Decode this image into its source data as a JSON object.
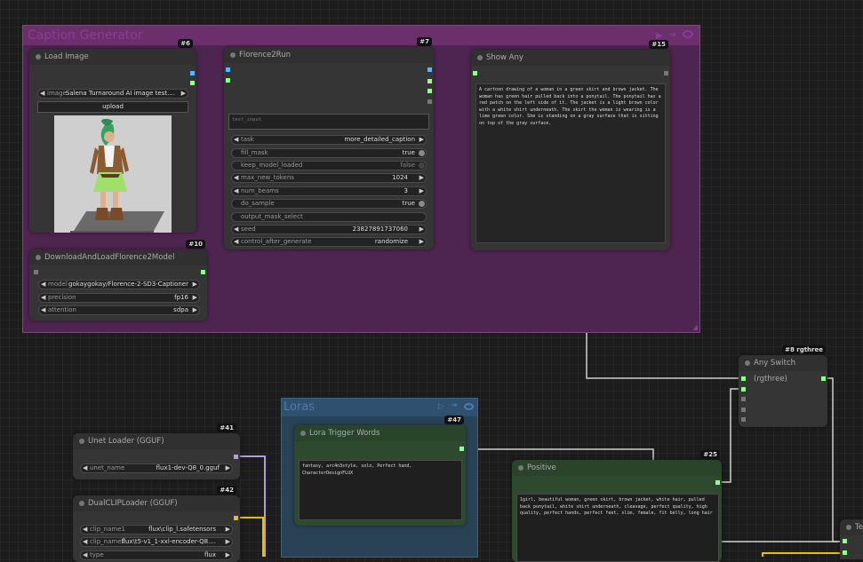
{
  "colors": {
    "canvas": "#1c1c1c",
    "caption_group": "#5a2a5a",
    "loras_group": "#2b4559",
    "green_node": "#2d4a2f",
    "socket_green": "#8fff8f",
    "socket_blue": "#5ab4ff",
    "wire_yellow": "#e6c300",
    "wire_purple": "#b39ddb"
  },
  "groups": {
    "caption": {
      "title": "Caption Generator"
    },
    "loras": {
      "title": "Loras"
    }
  },
  "icons": [
    "play-icon",
    "bypass-icon",
    "eye-icon"
  ],
  "nodes": {
    "load_image": {
      "title": "Load Image",
      "badge": "#6",
      "image": {
        "label": "image",
        "value": "Salena Turnaround AI image test...."
      },
      "upload_label": "upload"
    },
    "download_florence": {
      "title": "DownloadAndLoadFlorence2Model",
      "badge": "#10",
      "model": {
        "label": "model",
        "value": "gokaygokay/Florence-2-SD3-Captioner"
      },
      "precision": {
        "label": "precision",
        "value": "fp16"
      },
      "attention": {
        "label": "attention",
        "value": "sdpa"
      }
    },
    "florence2run": {
      "title": "Florence2Run",
      "badge": "#7",
      "text_input_placeholder": "text_input",
      "task": {
        "label": "task",
        "value": "more_detailed_caption"
      },
      "fill_mask": {
        "label": "fill_mask",
        "value": "true"
      },
      "keep_model_loaded": {
        "label": "keep_model_loaded",
        "value": "false"
      },
      "max_new_tokens": {
        "label": "max_new_tokens",
        "value": "1024"
      },
      "num_beams": {
        "label": "num_beams",
        "value": "3"
      },
      "do_sample": {
        "label": "do_sample",
        "value": "true"
      },
      "output_mask_select": {
        "label": "output_mask_select"
      },
      "seed": {
        "label": "seed",
        "value": "238278917370​60"
      },
      "control_after_generate": {
        "label": "control_after_generate",
        "value": "randomize"
      }
    },
    "show_any": {
      "title": "Show Any",
      "badge": "#15",
      "text": "A cartoon drawing of a woman in a green skirt and brown jacket. The woman has green hair pulled back into a ponytail. The ponytail has a red patch on the left side of it. The jacket is a light brown color with a white shirt underneath. The skirt the woman is wearing is a lime green color. She is standing on a gray surface that is sitting on top of the gray surface."
    },
    "any_switch": {
      "title": "Any Switch (rgthree)",
      "badge": "#8 rgthree"
    },
    "unet_loader": {
      "title": "Unet Loader (GGUF)",
      "badge": "#41",
      "unet_name": {
        "label": "unet_name",
        "value": "flux1-dev-Q8_0.gguf"
      }
    },
    "dualclip": {
      "title": "DualCLIPLoader (GGUF)",
      "badge": "#42",
      "clip_name1": {
        "label": "clip_name1",
        "value": "flux\\clip_l.safetensors"
      },
      "clip_name2": {
        "label": "clip_name2",
        "value": "flux\\t5-v1_1-xxl-encoder-Q8...."
      },
      "type": {
        "label": "type",
        "value": "flux"
      }
    },
    "lora_trigger": {
      "title": "Lora Trigger Words",
      "badge": "#47",
      "text": "fantasy, arc4n3style, solo, Perfect hand, CharacterDesignFLUX"
    },
    "positive": {
      "title": "Positive",
      "badge": "#25",
      "text": "1girl, beautiful woman, green skirt, brown jacket, white hair, pulled back ponytail, white shirt underneath, cleavage, perfect quality, high quality, perfect hands, perfect feet, slim, female, fit belly, long hair"
    },
    "partial": {
      "title": "Te"
    }
  }
}
